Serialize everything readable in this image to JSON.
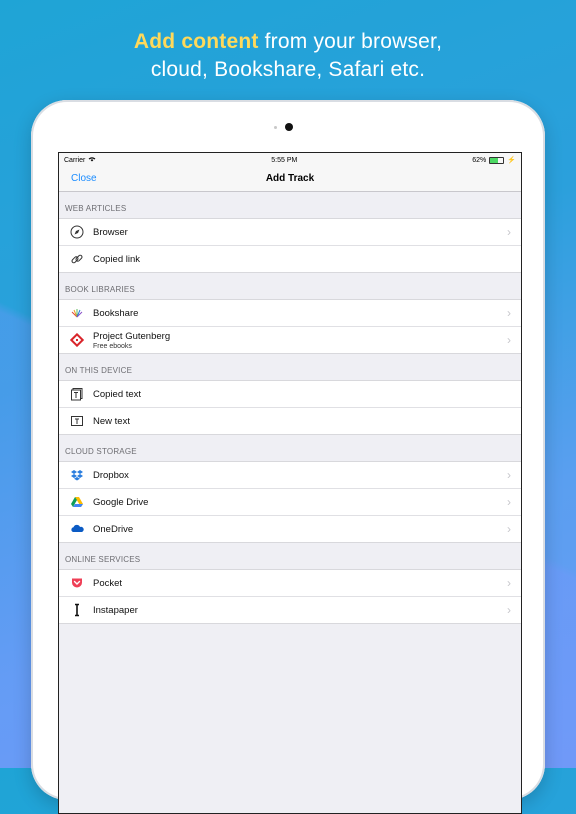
{
  "headline": {
    "accent": "Add content",
    "rest_line1": " from your browser,",
    "line2": "cloud, Bookshare, Safari etc."
  },
  "statusbar": {
    "carrier": "Carrier",
    "time": "5:55 PM",
    "battery_pct": "62%",
    "battery_level": 0.62
  },
  "navbar": {
    "close_label": "Close",
    "title": "Add Track"
  },
  "sections": [
    {
      "header": "WEB ARTICLES",
      "rows": [
        {
          "label": "Browser",
          "chevron": true,
          "icon": "compass-icon"
        },
        {
          "label": "Copied link",
          "chevron": false,
          "icon": "link-icon"
        }
      ]
    },
    {
      "header": "BOOK LIBRARIES",
      "rows": [
        {
          "label": "Bookshare",
          "chevron": true,
          "icon": "bookshare-icon"
        },
        {
          "label": "Project Gutenberg",
          "sub": "Free ebooks",
          "chevron": true,
          "icon": "gutenberg-icon"
        }
      ]
    },
    {
      "header": "ON THIS DEVICE",
      "rows": [
        {
          "label": "Copied text",
          "chevron": false,
          "icon": "copied-text-icon"
        },
        {
          "label": "New text",
          "chevron": false,
          "icon": "new-text-icon"
        }
      ]
    },
    {
      "header": "CLOUD STORAGE",
      "rows": [
        {
          "label": "Dropbox",
          "chevron": true,
          "icon": "dropbox-icon"
        },
        {
          "label": "Google Drive",
          "chevron": true,
          "icon": "google-drive-icon"
        },
        {
          "label": "OneDrive",
          "chevron": true,
          "icon": "onedrive-icon"
        }
      ]
    },
    {
      "header": "ONLINE SERVICES",
      "rows": [
        {
          "label": "Pocket",
          "chevron": true,
          "icon": "pocket-icon"
        },
        {
          "label": "Instapaper",
          "chevron": true,
          "icon": "instapaper-icon"
        }
      ]
    }
  ],
  "colors": {
    "link": "#1a8cff",
    "accent_text": "#ffd95a"
  }
}
